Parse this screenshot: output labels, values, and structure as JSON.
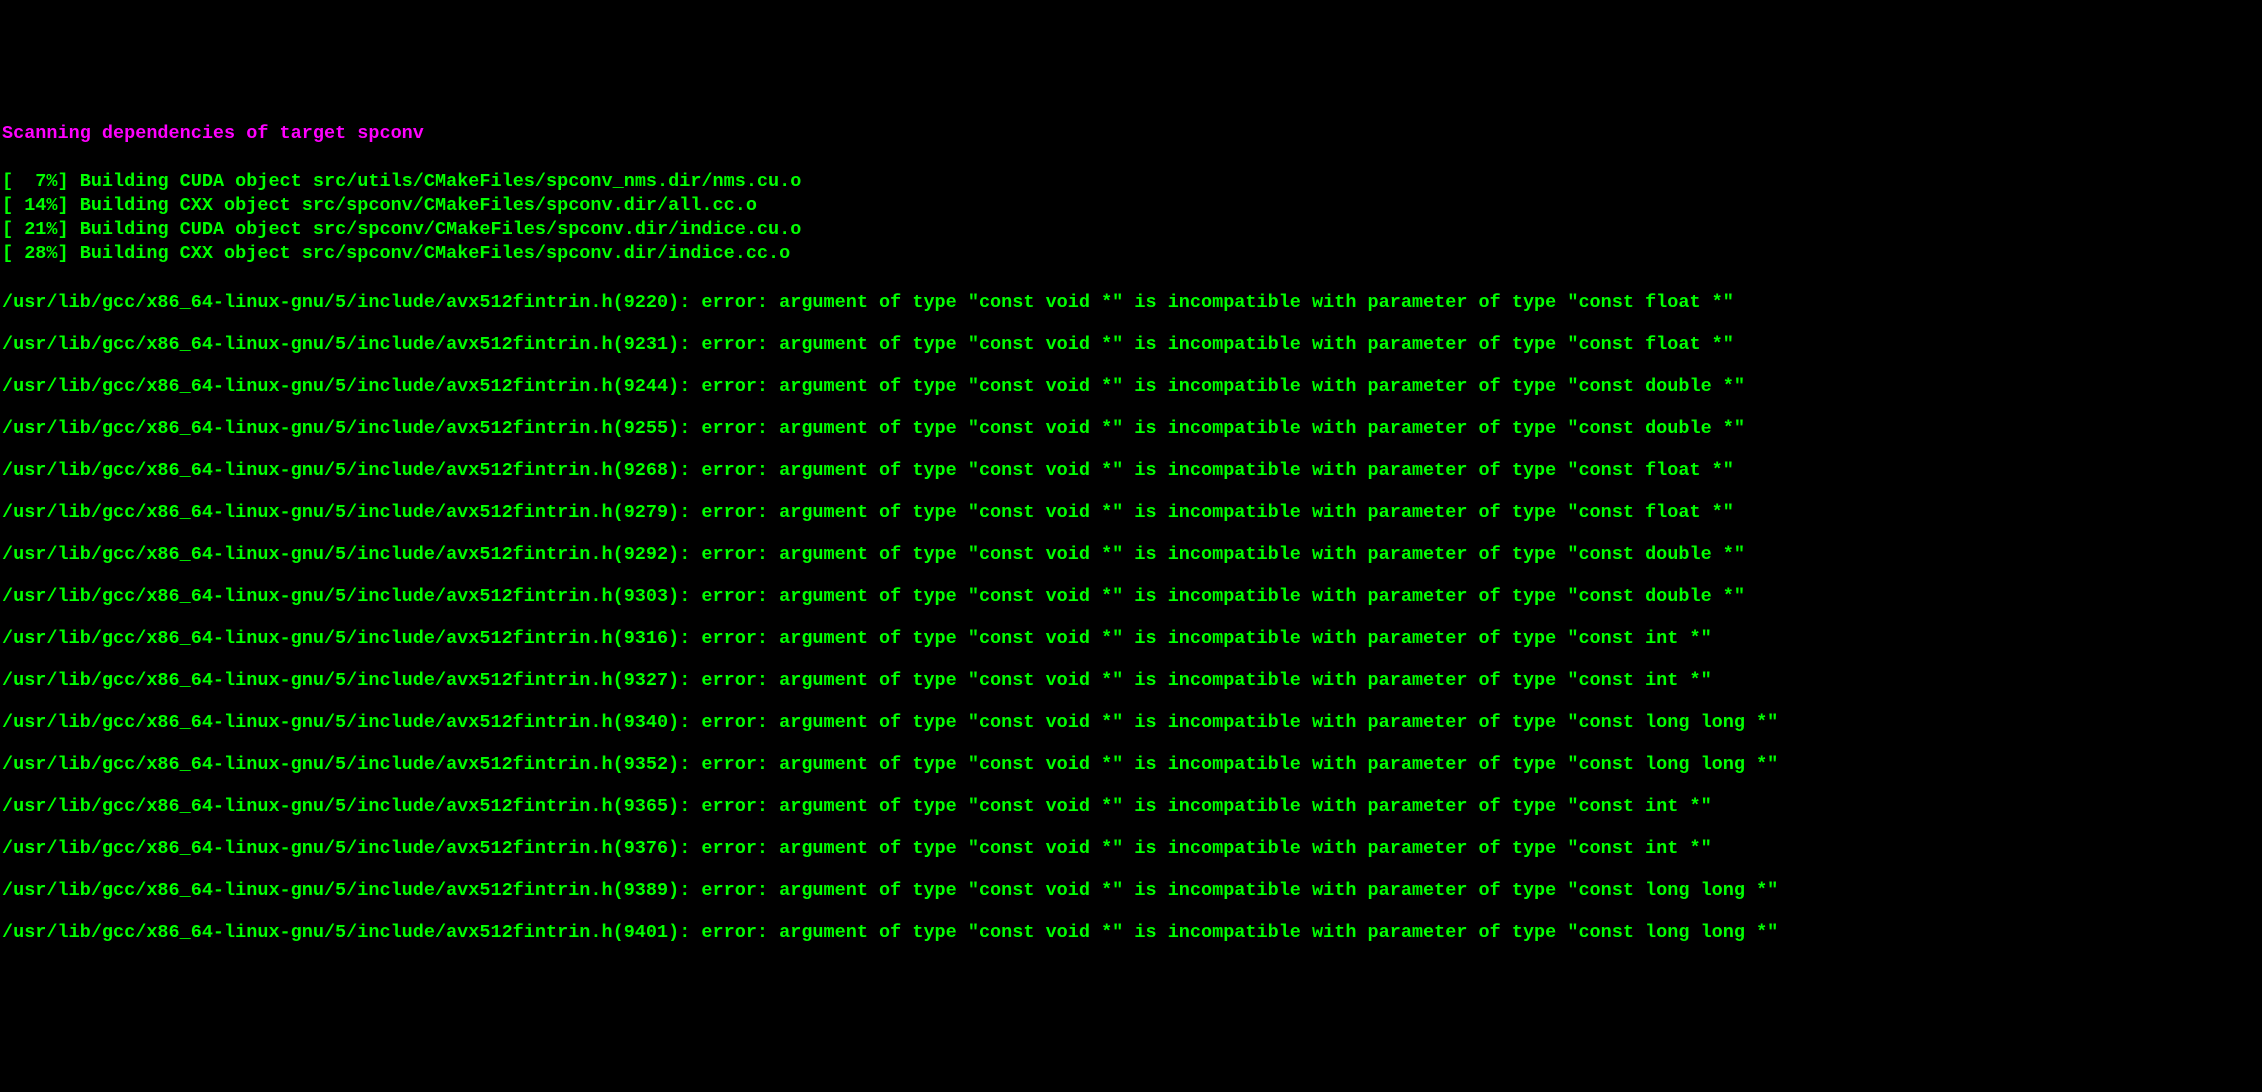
{
  "header": "Scanning dependencies of target spconv",
  "build_lines": [
    {
      "percent": "[  7%]",
      "text": " Building CUDA object src/utils/CMakeFiles/spconv_nms.dir/nms.cu.o"
    },
    {
      "percent": "[ 14%]",
      "text": " Building CXX object src/spconv/CMakeFiles/spconv.dir/all.cc.o"
    },
    {
      "percent": "[ 21%]",
      "text": " Building CUDA object src/spconv/CMakeFiles/spconv.dir/indice.cu.o"
    },
    {
      "percent": "[ 28%]",
      "text": " Building CXX object src/spconv/CMakeFiles/spconv.dir/indice.cc.o"
    }
  ],
  "error_prefix": "/usr/lib/gcc/x86_64-linux-gnu/5/include/avx512fintrin.h",
  "errors": [
    {
      "line": "9220",
      "param_type": "const float *"
    },
    {
      "line": "9231",
      "param_type": "const float *"
    },
    {
      "line": "9244",
      "param_type": "const double *"
    },
    {
      "line": "9255",
      "param_type": "const double *"
    },
    {
      "line": "9268",
      "param_type": "const float *"
    },
    {
      "line": "9279",
      "param_type": "const float *"
    },
    {
      "line": "9292",
      "param_type": "const double *"
    },
    {
      "line": "9303",
      "param_type": "const double *"
    },
    {
      "line": "9316",
      "param_type": "const int *"
    },
    {
      "line": "9327",
      "param_type": "const int *"
    },
    {
      "line": "9340",
      "param_type": "const long long *"
    },
    {
      "line": "9352",
      "param_type": "const long long *"
    },
    {
      "line": "9365",
      "param_type": "const int *"
    },
    {
      "line": "9376",
      "param_type": "const int *"
    },
    {
      "line": "9389",
      "param_type": "const long long *"
    },
    {
      "line": "9401",
      "param_type": "const long long *"
    }
  ],
  "error_msg_part1": ": error: argument of type \"const void *\" is incompatible with parameter of type \"",
  "error_msg_part2": "\""
}
